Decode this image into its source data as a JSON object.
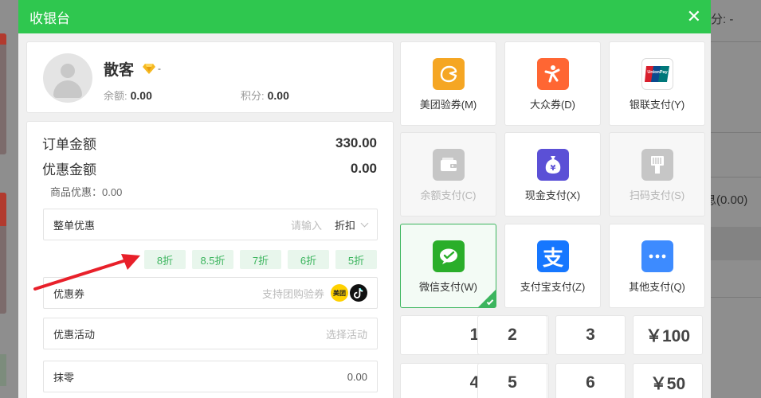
{
  "background": {
    "right_top_text": "分: -",
    "right_mid_text": "息(0.00)"
  },
  "modal": {
    "title": "收银台",
    "close_icon": "close-icon"
  },
  "customer": {
    "name": "散客",
    "vip_suffix": "-",
    "balance_label": "余额:",
    "balance_value": "0.00",
    "points_label": "积分:",
    "points_value": "0.00"
  },
  "order": {
    "order_amount_label": "订单金额",
    "order_amount_value": "330.00",
    "discount_amount_label": "优惠金额",
    "discount_amount_value": "0.00",
    "goods_discount": "商品优惠：0.00",
    "whole_discount_label": "整单优惠",
    "whole_discount_placeholder": "请输入",
    "whole_discount_mode": "折扣",
    "discount_chips": [
      "8折",
      "8.5折",
      "7折",
      "6折",
      "5折"
    ],
    "coupon_label": "优惠券",
    "coupon_placeholder": "支持团购验券",
    "meituan_logo_text": "美团",
    "activity_label": "优惠活动",
    "activity_placeholder": "选择活动",
    "rounding_label": "抹零",
    "rounding_value": "0.00"
  },
  "payments": [
    {
      "label": "美团验券(M)",
      "icon": "meituan-coupon-icon",
      "color": "#f5a623",
      "state": "normal"
    },
    {
      "label": "大众券(D)",
      "icon": "dianping-icon",
      "color": "#ff6633",
      "state": "normal"
    },
    {
      "label": "银联支付(Y)",
      "icon": "unionpay-icon",
      "color": "#ffffff",
      "state": "normal"
    },
    {
      "label": "余额支付(C)",
      "icon": "wallet-icon",
      "color": "#c6c6c6",
      "state": "disabled"
    },
    {
      "label": "现金支付(X)",
      "icon": "cash-bag-icon",
      "color": "#5b50d6",
      "state": "normal"
    },
    {
      "label": "扫码支付(S)",
      "icon": "scan-icon",
      "color": "#c6c6c6",
      "state": "disabled"
    },
    {
      "label": "微信支付(W)",
      "icon": "wechat-pay-icon",
      "color": "#2aae2a",
      "state": "selected"
    },
    {
      "label": "支付宝支付(Z)",
      "icon": "alipay-icon",
      "color": "#1677ff",
      "state": "normal"
    },
    {
      "label": "其他支付(Q)",
      "icon": "more-icon",
      "color": "#3d8bff",
      "state": "normal"
    }
  ],
  "keypad": [
    "1",
    "2",
    "3",
    "￥100",
    "4",
    "5",
    "6",
    "￥50"
  ],
  "unionpay_text": "UnionPay",
  "yen_symbol": "¥",
  "alipay_char": "支"
}
